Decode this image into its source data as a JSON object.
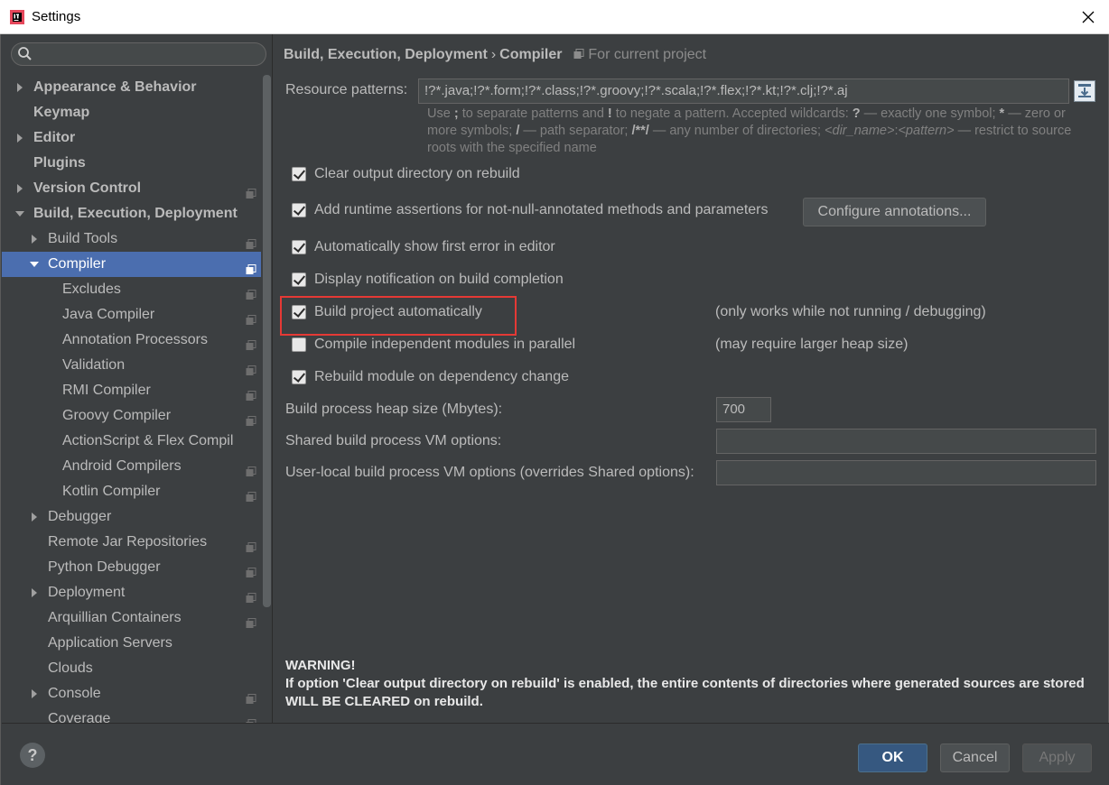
{
  "window": {
    "title": "Settings"
  },
  "sidebar": {
    "search_placeholder": "",
    "items": [
      {
        "label": "Appearance & Behavior",
        "level": 0,
        "arrow": "right",
        "bold": true,
        "proj": false
      },
      {
        "label": "Keymap",
        "level": 0,
        "arrow": "",
        "bold": true,
        "proj": false
      },
      {
        "label": "Editor",
        "level": 0,
        "arrow": "right",
        "bold": true,
        "proj": false
      },
      {
        "label": "Plugins",
        "level": 0,
        "arrow": "",
        "bold": true,
        "proj": false
      },
      {
        "label": "Version Control",
        "level": 0,
        "arrow": "right",
        "bold": true,
        "proj": true
      },
      {
        "label": "Build, Execution, Deployment",
        "level": 0,
        "arrow": "down",
        "bold": true,
        "proj": false
      },
      {
        "label": "Build Tools",
        "level": 1,
        "arrow": "right",
        "bold": false,
        "proj": true
      },
      {
        "label": "Compiler",
        "level": 1,
        "arrow": "down",
        "bold": false,
        "proj": true,
        "selected": true
      },
      {
        "label": "Excludes",
        "level": 2,
        "arrow": "",
        "bold": false,
        "proj": true
      },
      {
        "label": "Java Compiler",
        "level": 2,
        "arrow": "",
        "bold": false,
        "proj": true
      },
      {
        "label": "Annotation Processors",
        "level": 2,
        "arrow": "",
        "bold": false,
        "proj": true
      },
      {
        "label": "Validation",
        "level": 2,
        "arrow": "",
        "bold": false,
        "proj": true
      },
      {
        "label": "RMI Compiler",
        "level": 2,
        "arrow": "",
        "bold": false,
        "proj": true
      },
      {
        "label": "Groovy Compiler",
        "level": 2,
        "arrow": "",
        "bold": false,
        "proj": true
      },
      {
        "label": "ActionScript & Flex Compil",
        "level": 2,
        "arrow": "",
        "bold": false,
        "proj": false
      },
      {
        "label": "Android Compilers",
        "level": 2,
        "arrow": "",
        "bold": false,
        "proj": true
      },
      {
        "label": "Kotlin Compiler",
        "level": 2,
        "arrow": "",
        "bold": false,
        "proj": true
      },
      {
        "label": "Debugger",
        "level": 1,
        "arrow": "right",
        "bold": false,
        "proj": false
      },
      {
        "label": "Remote Jar Repositories",
        "level": 1,
        "arrow": "",
        "bold": false,
        "proj": true
      },
      {
        "label": "Python Debugger",
        "level": 1,
        "arrow": "",
        "bold": false,
        "proj": true
      },
      {
        "label": "Deployment",
        "level": 1,
        "arrow": "right",
        "bold": false,
        "proj": true
      },
      {
        "label": "Arquillian Containers",
        "level": 1,
        "arrow": "",
        "bold": false,
        "proj": true
      },
      {
        "label": "Application Servers",
        "level": 1,
        "arrow": "",
        "bold": false,
        "proj": false
      },
      {
        "label": "Clouds",
        "level": 1,
        "arrow": "",
        "bold": false,
        "proj": false
      },
      {
        "label": "Console",
        "level": 1,
        "arrow": "right",
        "bold": false,
        "proj": true
      },
      {
        "label": "Coverage",
        "level": 1,
        "arrow": "",
        "bold": false,
        "proj": true
      }
    ]
  },
  "breadcrumb": {
    "part1": "Build, Execution, Deployment",
    "separator": "›",
    "part2": "Compiler",
    "scope": "For current project"
  },
  "resource": {
    "label": "Resource patterns:",
    "value": "!?*.java;!?*.form;!?*.class;!?*.groovy;!?*.scala;!?*.flex;!?*.kt;!?*.clj;!?*.aj"
  },
  "hint": {
    "t1": "Use ",
    "b1": ";",
    "t2": " to separate patterns and ",
    "b2": "!",
    "t3": " to negate a pattern. Accepted wildcards: ",
    "b3": "?",
    "t4": " — exactly one symbol; ",
    "b4": "*",
    "t5": " — zero or more symbols; ",
    "b5": "/",
    "t6": " — path separator; ",
    "b6": "/**/",
    "t7": " — any number of directories; ",
    "i1": "<dir_name>",
    "t8": ":",
    "i2": "<pattern>",
    "t9": " — restrict to source roots with the specified name"
  },
  "options": {
    "clear_output": {
      "label": "Clear output directory on rebuild",
      "checked": true
    },
    "runtime_assertions": {
      "label": "Add runtime assertions for not-null-annotated methods and parameters",
      "checked": true
    },
    "show_first_error": {
      "label": "Automatically show first error in editor",
      "checked": true
    },
    "notify_completion": {
      "label": "Display notification on build completion",
      "checked": true
    },
    "build_auto": {
      "label": "Build project automatically",
      "checked": true,
      "note": "(only works while not running / debugging)"
    },
    "parallel": {
      "label": "Compile independent modules in parallel",
      "checked": false,
      "note": "(may require larger heap size)"
    },
    "rebuild_dep": {
      "label": "Rebuild module on dependency change",
      "checked": true
    }
  },
  "configure_button": "Configure annotations...",
  "heap": {
    "label": "Build process heap size (Mbytes):",
    "value": "700"
  },
  "shared_vm": {
    "label": "Shared build process VM options:",
    "value": ""
  },
  "user_vm": {
    "label": "User-local build process VM options (overrides Shared options):",
    "value": ""
  },
  "warning": {
    "title": "WARNING!",
    "text": "If option 'Clear output directory on rebuild' is enabled, the entire contents of directories where generated sources are stored WILL BE CLEARED on rebuild."
  },
  "footer": {
    "help": "?",
    "ok": "OK",
    "cancel": "Cancel",
    "apply": "Apply"
  },
  "colors": {
    "background": "#3c3f41",
    "selection": "#4b6eaf",
    "highlight_box": "#e53935",
    "ok_button": "#365880"
  }
}
